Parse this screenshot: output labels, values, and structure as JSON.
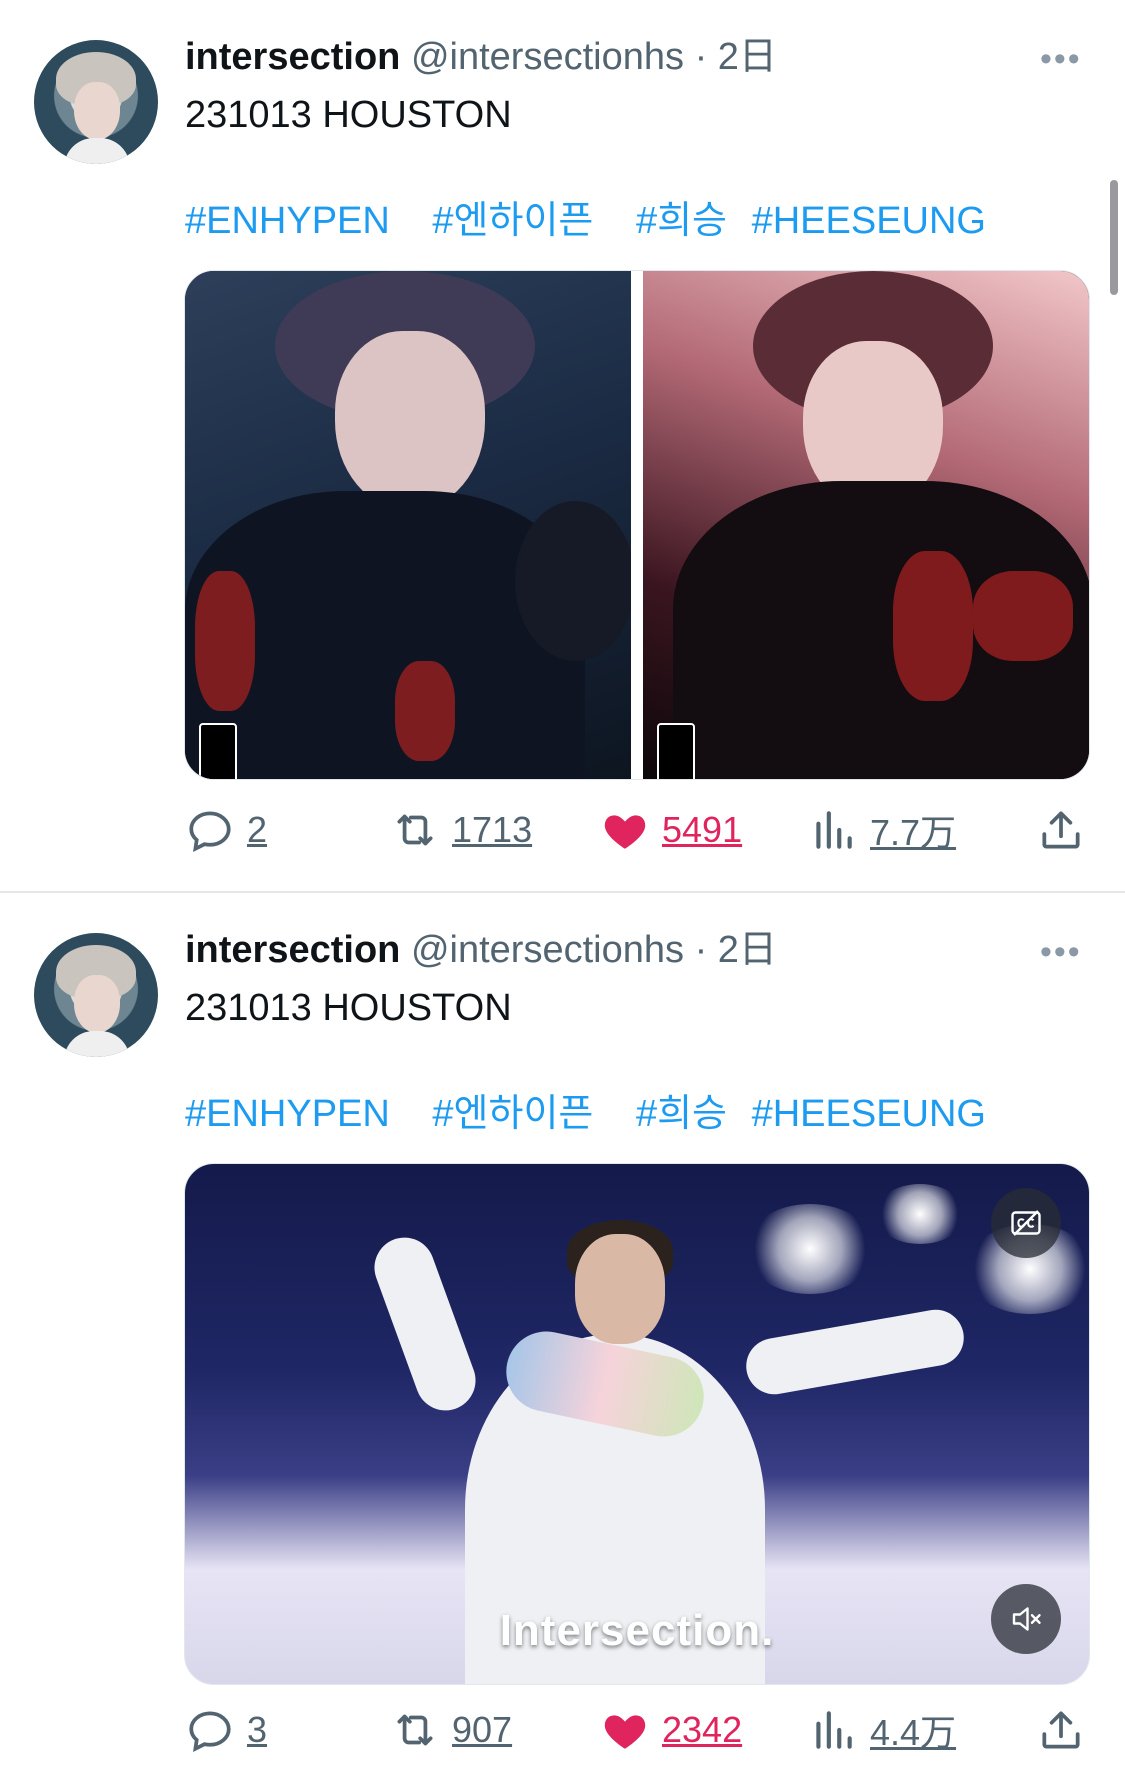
{
  "tweets": [
    {
      "author_name": "intersection",
      "handle": "@intersectionhs",
      "separator": "·",
      "time": "2日",
      "text": "231013 HOUSTON",
      "hashtags": [
        "#ENHYPEN",
        "#엔하이픈",
        "#희승",
        "#HEESEUNG"
      ],
      "media_type": "photos",
      "photo_count": 2,
      "counts": {
        "replies": "2",
        "retweets": "1713",
        "likes": "5491",
        "views": "7.7万"
      },
      "liked": true
    },
    {
      "author_name": "intersection",
      "handle": "@intersectionhs",
      "separator": "·",
      "time": "2日",
      "text": "231013 HOUSTON",
      "hashtags": [
        "#ENHYPEN",
        "#엔하이픈",
        "#희승",
        "#HEESEUNG"
      ],
      "media_type": "video",
      "video_caption": "Intersection.",
      "counts": {
        "replies": "3",
        "retweets": "907",
        "likes": "2342",
        "views": "4.4万"
      },
      "liked": true
    }
  ],
  "icons": {
    "more": "more-horizontal-icon",
    "reply": "reply-bubble-icon",
    "retweet": "retweet-icon",
    "like": "heart-filled-icon",
    "views": "bar-chart-icon",
    "share": "share-upload-icon",
    "captions": "captions-toggle-icon",
    "mute": "speaker-muted-icon"
  },
  "colors": {
    "link": "#1d9bf0",
    "like": "#e0245e",
    "secondary_text": "#536471",
    "divider": "#e6e6e6"
  }
}
